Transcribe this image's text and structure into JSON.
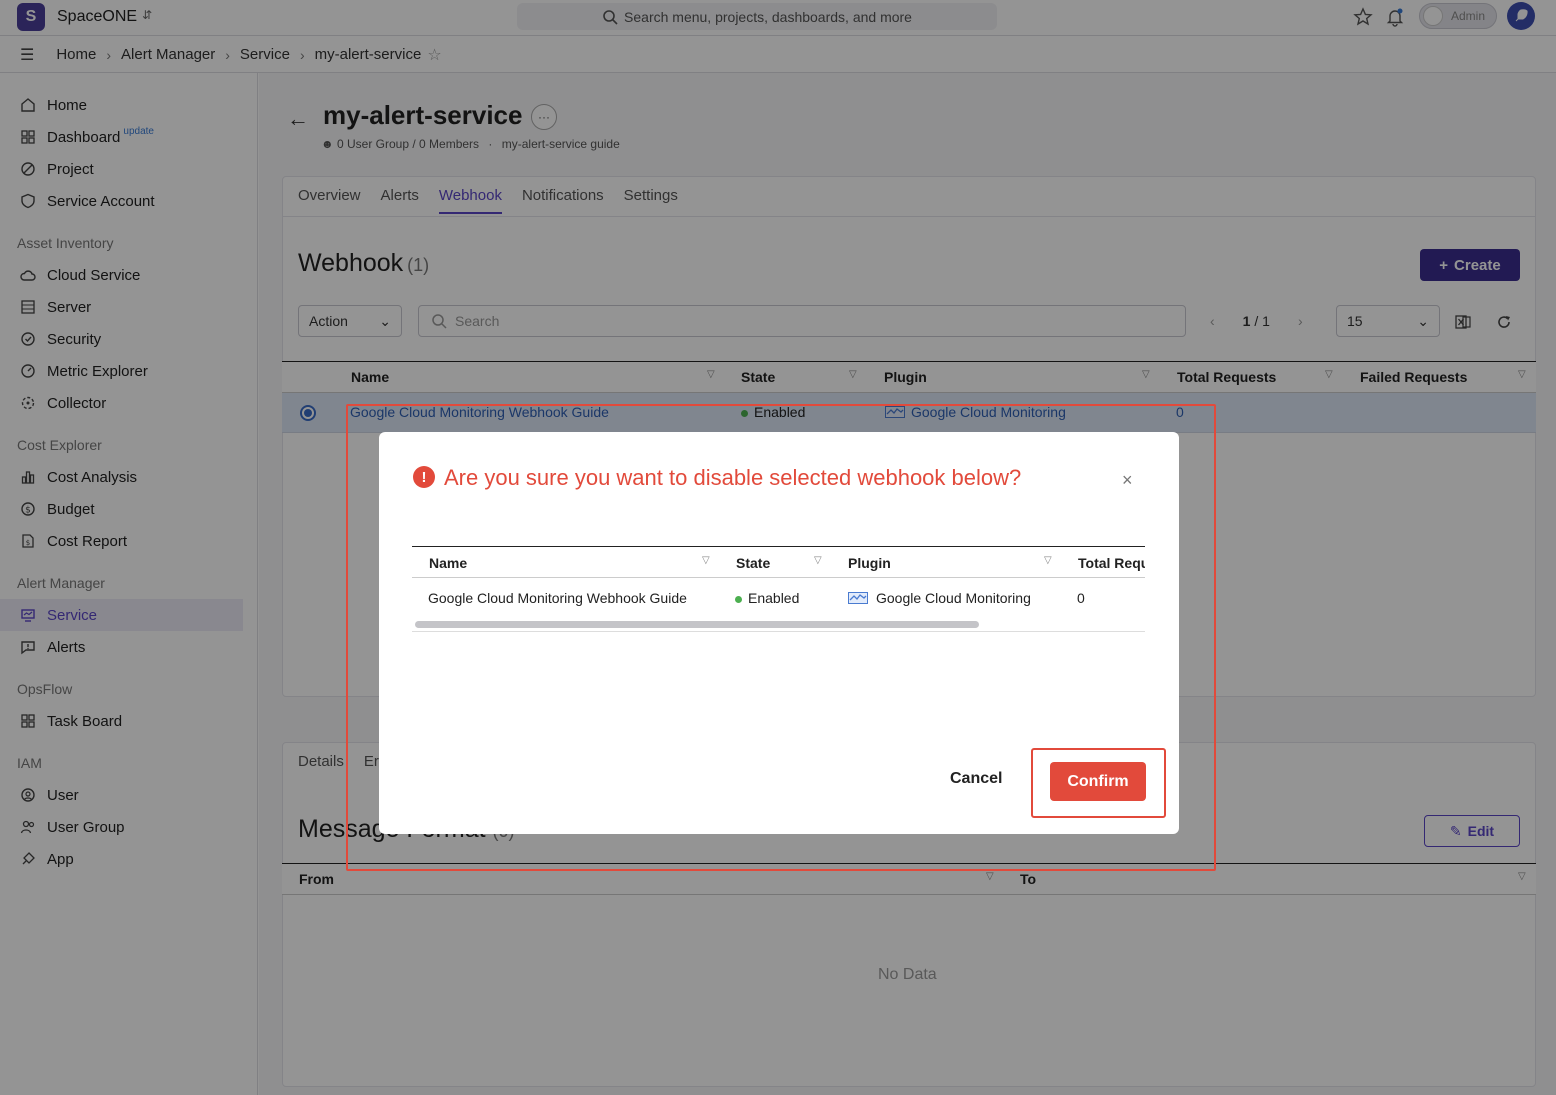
{
  "app": {
    "logo_letter": "S",
    "name": "SpaceONE"
  },
  "global_search": {
    "placeholder": "Search menu, projects, dashboards, and more"
  },
  "admin_toggle": {
    "label": "Admin"
  },
  "breadcrumb": [
    "Home",
    "Alert Manager",
    "Service",
    "my-alert-service"
  ],
  "sidebar": {
    "items_top": [
      {
        "label": "Home",
        "icon": "home-icon"
      },
      {
        "label": "Dashboard",
        "icon": "dashboard-icon",
        "badge": "update"
      },
      {
        "label": "Project",
        "icon": "project-icon"
      },
      {
        "label": "Service Account",
        "icon": "shield-icon"
      }
    ],
    "sections": [
      {
        "title": "Asset Inventory",
        "items": [
          "Cloud Service",
          "Server",
          "Security",
          "Metric Explorer",
          "Collector"
        ]
      },
      {
        "title": "Cost Explorer",
        "items": [
          "Cost Analysis",
          "Budget",
          "Cost Report"
        ]
      },
      {
        "title": "Alert Manager",
        "items": [
          "Service",
          "Alerts"
        ]
      },
      {
        "title": "OpsFlow",
        "items": [
          "Task Board"
        ]
      },
      {
        "title": "IAM",
        "items": [
          "User",
          "User Group",
          "App"
        ]
      }
    ],
    "active": "Service"
  },
  "page": {
    "title": "my-alert-service",
    "subinfo_groups": "0 User Group / 0 Members",
    "subinfo_sep": "·",
    "subinfo_guide": "my-alert-service guide",
    "tabs": [
      "Overview",
      "Alerts",
      "Webhook",
      "Notifications",
      "Settings"
    ],
    "active_tab": "Webhook"
  },
  "webhook": {
    "title": "Webhook",
    "count": "(1)",
    "create_label": "Create",
    "action_label": "Action",
    "search_placeholder": "Search",
    "page_current": "1",
    "page_total": "/ 1",
    "page_size": "15",
    "columns": [
      "Name",
      "State",
      "Plugin",
      "Total Requests",
      "Failed Requests"
    ],
    "rows": [
      {
        "name": "Google Cloud Monitoring Webhook Guide",
        "state": "Enabled",
        "plugin": "Google Cloud Monitoring",
        "total_requests": "0"
      }
    ]
  },
  "details": {
    "tabs": [
      "Details",
      "Er"
    ],
    "message_title": "Message Format",
    "message_count": "(0)",
    "edit_label": "Edit",
    "columns": [
      "From",
      "To"
    ],
    "empty_text": "No Data"
  },
  "modal": {
    "title": "Are you sure you want to disable selected webhook below?",
    "close_label": "×",
    "columns": [
      "Name",
      "State",
      "Plugin",
      "Total Requ"
    ],
    "row": {
      "name": "Google Cloud Monitoring Webhook Guide",
      "state": "Enabled",
      "plugin": "Google Cloud Monitoring",
      "total_requests": "0"
    },
    "cancel_label": "Cancel",
    "confirm_label": "Confirm"
  },
  "colors": {
    "brand": "#4b3e9a",
    "accent": "#5b46c7",
    "danger": "#e24a3b",
    "link": "#2f5fb3",
    "enabled": "#4caf50"
  }
}
